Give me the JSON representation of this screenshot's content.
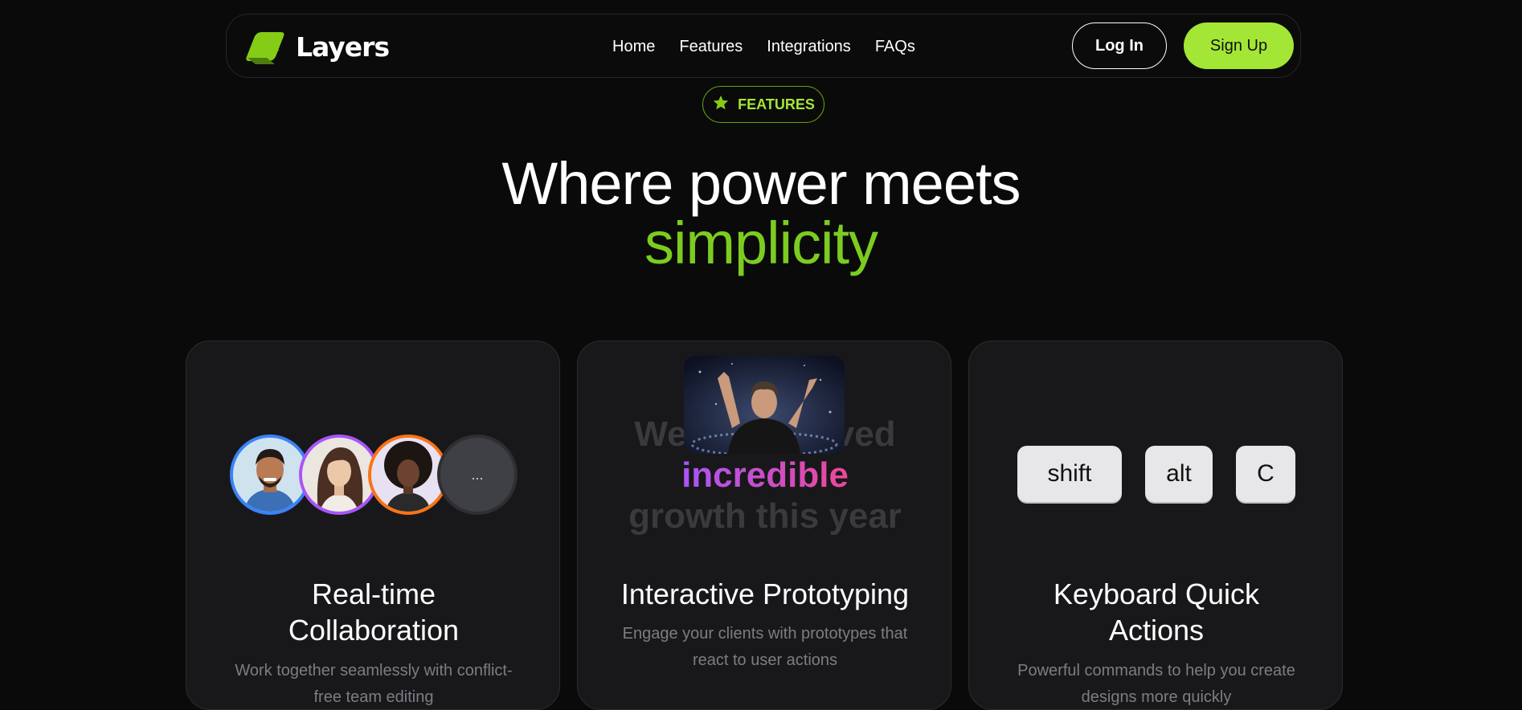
{
  "brand": {
    "name": "Layers",
    "accent": "#a3e635",
    "logo_icon": "layers-logo-icon"
  },
  "nav": {
    "items": [
      {
        "label": "Home"
      },
      {
        "label": "Features"
      },
      {
        "label": "Integrations"
      },
      {
        "label": "FAQs"
      }
    ],
    "login_label": "Log In",
    "signup_label": "Sign Up"
  },
  "badge": {
    "icon": "star-icon",
    "label": "FEATURES"
  },
  "headline": {
    "line1": "Where power meets",
    "line2": "simplicity"
  },
  "cards": [
    {
      "title_line1": "Real-time",
      "title_line2": "Collaboration",
      "desc_line1": "Work together seamlessly with conflict-",
      "desc_line2": "free team editing",
      "avatars": [
        {
          "name": "avatar-man",
          "ring": "#3b82f6"
        },
        {
          "name": "avatar-woman",
          "ring": "#a855f7"
        },
        {
          "name": "avatar-woman-curly",
          "ring": "#f97316"
        }
      ],
      "more_label": "..."
    },
    {
      "title": "Interactive Prototyping",
      "desc_line1": "Engage your clients with prototypes that",
      "desc_line2": "react to user actions",
      "text_line1": "We've achieved",
      "text_highlight": "incredible",
      "text_line3": "growth this year"
    },
    {
      "title_line1": "Keyboard Quick",
      "title_line2": "Actions",
      "desc_line1": "Powerful commands to help you create",
      "desc_line2": "designs more quickly",
      "keys": [
        "shift",
        "alt",
        "C"
      ]
    }
  ]
}
